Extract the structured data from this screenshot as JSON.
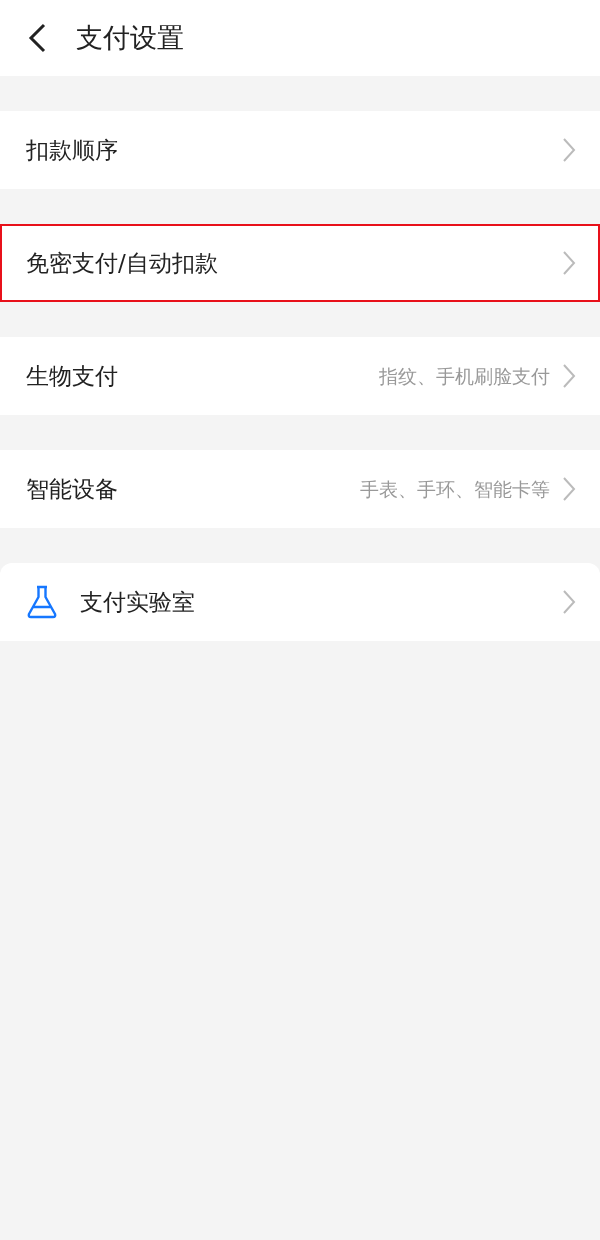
{
  "header": {
    "title": "支付设置"
  },
  "items": [
    {
      "kind": "plain",
      "label": "扣款顺序",
      "highlighted": false
    },
    {
      "kind": "plain",
      "label": "免密支付/自动扣款",
      "highlighted": true
    },
    {
      "kind": "plain",
      "label": "生物支付",
      "detail": "指纹、手机刷脸支付",
      "highlighted": false
    },
    {
      "kind": "plain",
      "label": "智能设备",
      "detail": "手表、手环、智能卡等",
      "highlighted": false
    },
    {
      "kind": "lab",
      "label": "支付实验室",
      "highlighted": false
    }
  ]
}
